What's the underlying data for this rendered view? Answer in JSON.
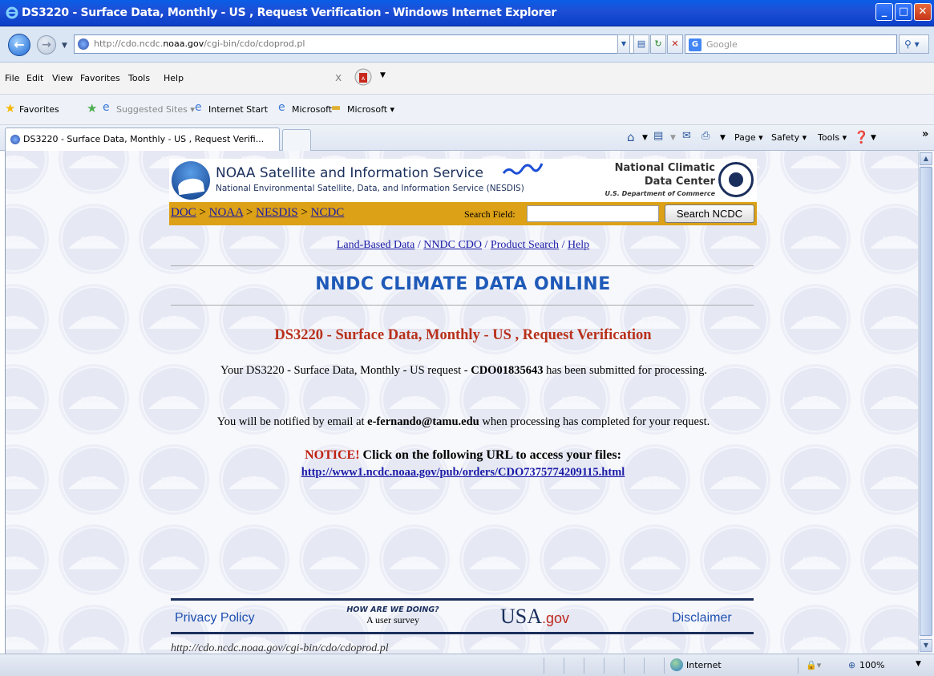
{
  "window": {
    "title": "DS3220 - Surface Data, Monthly - US , Request Verification - Windows Internet Explorer",
    "minimize": "_",
    "maximize": "□",
    "close": "✕"
  },
  "address_bar": {
    "url_prefix": "http://cdo.ncdc.",
    "url_domain": "noaa.gov",
    "url_suffix": "/cgi-bin/cdo/cdoprod.pl",
    "search_placeholder": "Google"
  },
  "menu": {
    "items": [
      "File",
      "Edit",
      "View",
      "Favorites",
      "Tools",
      "Help"
    ]
  },
  "favorites_bar": {
    "favorites_label": "Favorites",
    "suggested_sites": "Suggested Sites ▾",
    "internet_start": "Internet Start",
    "microsoft1": "Microsoft",
    "microsoft2": "Microsoft ▾"
  },
  "tab": {
    "label": "DS3220 - Surface Data, Monthly - US , Request Verifi..."
  },
  "command_bar": {
    "page": "Page ▾",
    "safety": "Safety ▾",
    "tools": "Tools ▾",
    "more": "»"
  },
  "page": {
    "header": {
      "title": "NOAA Satellite and Information Service",
      "subtitle": "National Environmental Satellite, Data, and Information Service (NESDIS)",
      "ncdc_line1": "National Climatic",
      "ncdc_line2": "Data Center",
      "ncdc_line3": "U.S. Department of Commerce"
    },
    "breadcrumb": {
      "doc": "DOC",
      "noaa": "NOAA",
      "nesdis": "NESDIS",
      "ncdc": "NCDC",
      "sep": " > "
    },
    "search": {
      "label": "Search Field:",
      "value": "",
      "button": "Search NCDC"
    },
    "sublinks": {
      "land": "Land-Based Data",
      "nndc": "NNDC CDO",
      "product": "Product Search",
      "help": "Help",
      "sep": " / "
    },
    "banner": "NNDC CLIMATE DATA ONLINE",
    "request_title": "DS3220 - Surface Data, Monthly - US , Request Verification",
    "para1_pre": "Your DS3220 - Surface Data, Monthly - US request - ",
    "para1_id": "CDO01835643",
    "para1_post": " has been submitted for processing.",
    "para2_pre": "You will be notified by email at ",
    "para2_email": "e-fernando@tamu.edu",
    "para2_post": " when processing has completed for your request.",
    "notice_label": "NOTICE!",
    "notice_text": " Click on the following URL to access your files:",
    "order_url": "http://www1.ncdc.noaa.gov/pub/orders/CDO7375774209115.html",
    "footer": {
      "privacy": "Privacy Policy",
      "survey_title": "HOW ARE WE DOING?",
      "survey_sub": "A user survey",
      "usa": "USA",
      "gov": ".gov",
      "disclaimer": "Disclaimer",
      "page_url": "http://cdo.ncdc.noaa.gov/cgi-bin/cdo/cdoprod.pl"
    }
  },
  "status_bar": {
    "zone": "Internet",
    "zoom": "100%"
  },
  "colors": {
    "title_bar": "#1d4fd6",
    "nav_bar": "#dca116",
    "banner_blue": "#1f5ab8",
    "request_title_red": "#b8301a",
    "link_blue": "#1a1aa6"
  }
}
